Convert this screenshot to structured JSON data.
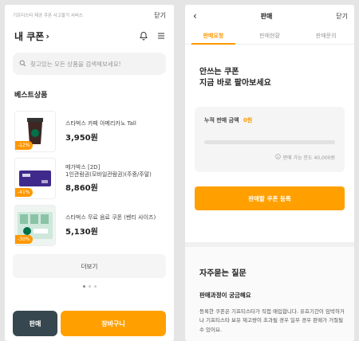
{
  "left": {
    "topbar": {
      "service_text": "기프티스타 제공 쿠폰 사고팔기 서비스",
      "close_label": "닫기"
    },
    "header": {
      "title": "내 쿠폰",
      "title_chevron": "›"
    },
    "search": {
      "placeholder": "찾고있는 모든 상품을 검색해보세요!"
    },
    "best": {
      "title": "베스트상품",
      "items": [
        {
          "name": "스타벅스 카페 아메리카노 Tall",
          "price": "3,950원",
          "discount": "-12%"
        },
        {
          "name": "메가박스 [2D]\n1인관람권(모바일관람권)(주중/주말)",
          "price": "8,860원",
          "discount": "-41%"
        },
        {
          "name": "스타벅스 무료 음료 쿠폰 (벤티 사이즈)",
          "price": "5,130원",
          "discount": "-30%"
        }
      ]
    },
    "more_label": "더보기",
    "buttons": {
      "sell": "판매",
      "cart": "장바구니"
    }
  },
  "right": {
    "header": {
      "back": "‹",
      "title": "판매",
      "close": "닫기"
    },
    "tabs": [
      "판매요청",
      "판매현황",
      "판매문의"
    ],
    "hero": {
      "line1": "안쓰는 쿠폰",
      "line2": "지금 바로 팔아보세요"
    },
    "sales": {
      "label": "누적 판매 금액",
      "amount": "0원",
      "progress": 0,
      "limit_text": "판매 가능 한도 40,000원"
    },
    "sell_button": "판매할 쿠폰 등록",
    "faq": {
      "title": "자주묻는 질문",
      "question": "판매과정이 궁금해요",
      "answer": "등록한 쿠폰은 기프티스타가 직접 매입합니다. 유효기간이 임박하거나 기프티스타 보유 재고량이 초과될 경우 일부 경우 판매가 거절될 수 있어요."
    }
  },
  "colors": {
    "accent": "#ffa000",
    "dark_button": "#37474f"
  }
}
